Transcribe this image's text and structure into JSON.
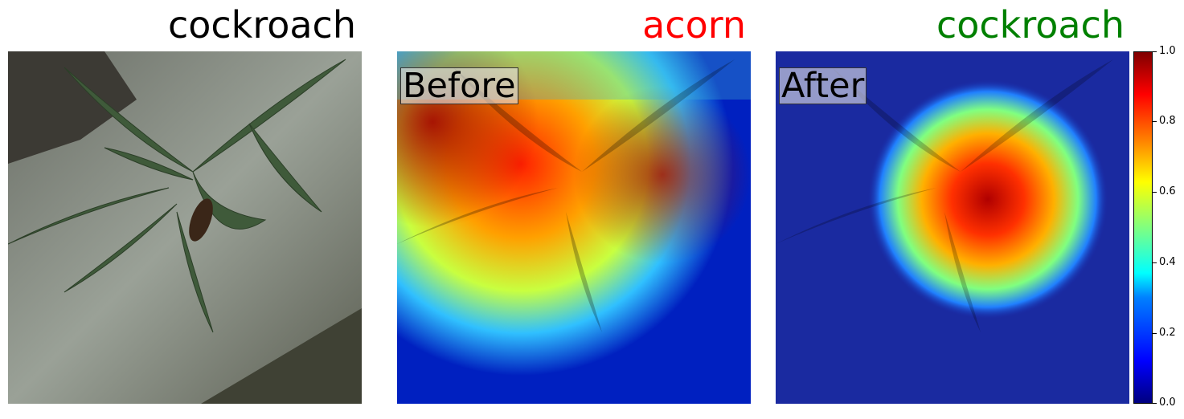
{
  "panels": [
    {
      "title": "cockroach",
      "title_color": "#000000",
      "tag": ""
    },
    {
      "title": "acorn",
      "title_color": "#ff0000",
      "tag": "Before"
    },
    {
      "title": "cockroach",
      "title_color": "#008000",
      "tag": "After"
    }
  ],
  "colorbar": {
    "colormap": "jet",
    "ticks": [
      "0.0",
      "0.2",
      "0.4",
      "0.6",
      "0.8",
      "1.0"
    ]
  }
}
